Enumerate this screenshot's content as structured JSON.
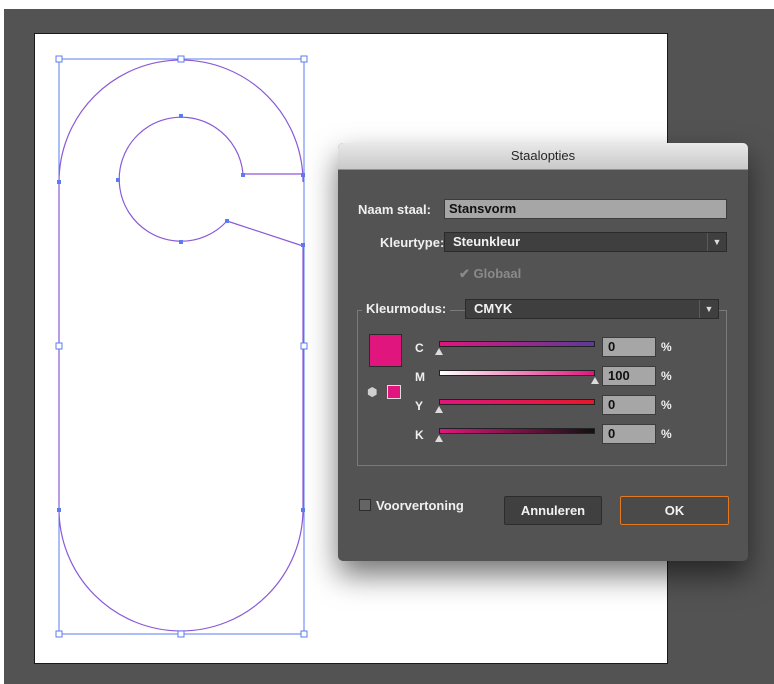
{
  "dialog": {
    "title": "Staalopties",
    "swatch_name_label": "Naam staal:",
    "swatch_name_value": "Stansvorm",
    "color_type_label": "Kleurtype:",
    "color_type_value": "Steunkleur",
    "global_label": "Globaal",
    "global_checked": true,
    "color_mode_label": "Kleurmodus:",
    "color_mode_value": "CMYK",
    "swatch_color": "#e0157e",
    "channels": [
      {
        "label": "C",
        "value": "0",
        "unit": "%",
        "level": 0
      },
      {
        "label": "M",
        "value": "100",
        "unit": "%",
        "level": 100
      },
      {
        "label": "Y",
        "value": "0",
        "unit": "%",
        "level": 0
      },
      {
        "label": "K",
        "value": "0",
        "unit": "%",
        "level": 0
      }
    ],
    "preview_label": "Voorvertoning",
    "preview_checked": false,
    "cancel_label": "Annuleren",
    "ok_label": "OK"
  },
  "colors": {
    "workspace": "#535353",
    "path_stroke": "#5b7bf0",
    "accent_ok": "#e3781e"
  },
  "icons": {
    "dropdown": "chevron-down-icon",
    "check": "checkmark-icon",
    "gamut_cube": "cube-icon",
    "slider_thumb": "triangle-up-icon"
  }
}
